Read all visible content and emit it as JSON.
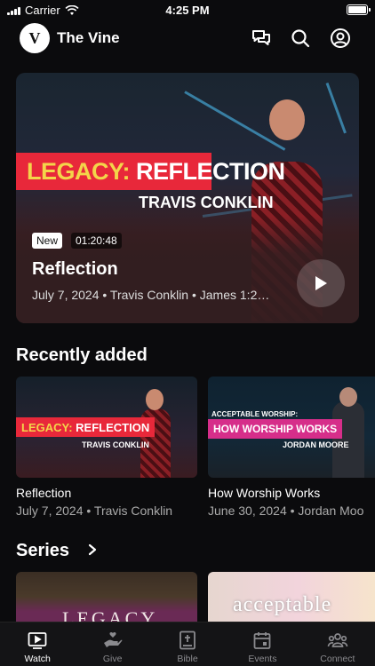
{
  "status_bar": {
    "carrier": "Carrier",
    "time": "4:25 PM"
  },
  "header": {
    "logo_letter": "V",
    "app_title": "The Vine",
    "icons": [
      "chat-bubbles-icon",
      "search-icon",
      "profile-icon"
    ]
  },
  "hero": {
    "banner_word1": "LEGACY:",
    "banner_word2": "REFLECTION",
    "speaker_caption": "TRAVIS CONKLIN",
    "badge_new": "New",
    "duration": "01:20:48",
    "title": "Reflection",
    "meta": "July 7, 2024 • Travis Conklin • James 1:2…"
  },
  "recently_added": {
    "title": "Recently added",
    "items": [
      {
        "banner_word1": "LEGACY:",
        "banner_word2": "REFLECTION",
        "sub": "TRAVIS CONKLIN",
        "title": "Reflection",
        "meta": "July 7, 2024 • Travis Conklin"
      },
      {
        "kicker": "ACCEPTABLE WORSHIP:",
        "banner": "HOW WORSHIP WORKS",
        "sub": "JORDAN MOORE",
        "title": "How Worship Works",
        "meta": "June 30, 2024 • Jordan Moo"
      }
    ]
  },
  "series": {
    "title": "Series",
    "items": [
      {
        "text": "LEGACY"
      },
      {
        "text": "acceptable"
      }
    ]
  },
  "tabbar": {
    "tabs": [
      {
        "label": "Watch",
        "icon": "watch-icon",
        "active": true
      },
      {
        "label": "Give",
        "icon": "give-icon",
        "active": false
      },
      {
        "label": "Bible",
        "icon": "bible-icon",
        "active": false
      },
      {
        "label": "Events",
        "icon": "calendar-icon",
        "active": false
      },
      {
        "label": "Connect",
        "icon": "people-icon",
        "active": false
      }
    ]
  }
}
